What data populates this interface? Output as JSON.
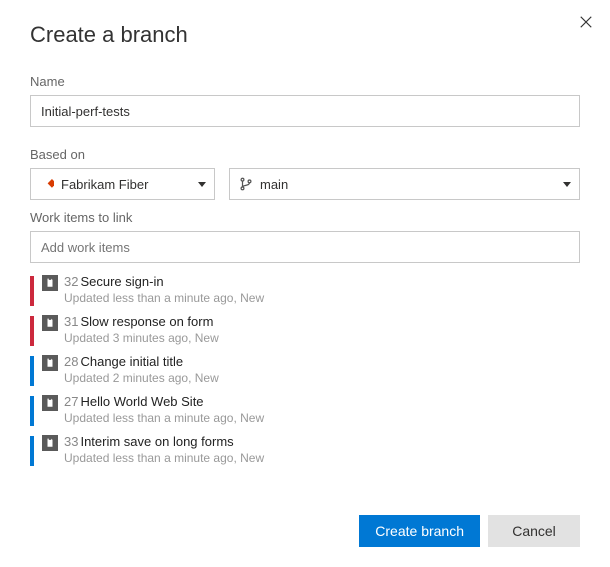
{
  "dialog": {
    "title": "Create a branch",
    "close_icon": "close"
  },
  "name_field": {
    "label": "Name",
    "value": "Initial-perf-tests"
  },
  "based_on": {
    "label": "Based on",
    "repo": "Fabrikam Fiber",
    "branch": "main"
  },
  "work_items_section": {
    "label": "Work items to link",
    "placeholder": "Add work items"
  },
  "work_items": [
    {
      "bar_color": "red",
      "id": "32",
      "title": "Secure sign-in",
      "meta": "Updated less than a minute ago, New"
    },
    {
      "bar_color": "red",
      "id": "31",
      "title": "Slow response on form",
      "meta": "Updated 3 minutes ago, New"
    },
    {
      "bar_color": "blue",
      "id": "28",
      "title": "Change initial title",
      "meta": "Updated 2 minutes ago, New"
    },
    {
      "bar_color": "blue",
      "id": "27",
      "title": "Hello World Web Site",
      "meta": "Updated less than a minute ago, New"
    },
    {
      "bar_color": "blue",
      "id": "33",
      "title": "Interim save on long forms",
      "meta": "Updated less than a minute ago, New"
    }
  ],
  "footer": {
    "primary": "Create branch",
    "secondary": "Cancel"
  }
}
